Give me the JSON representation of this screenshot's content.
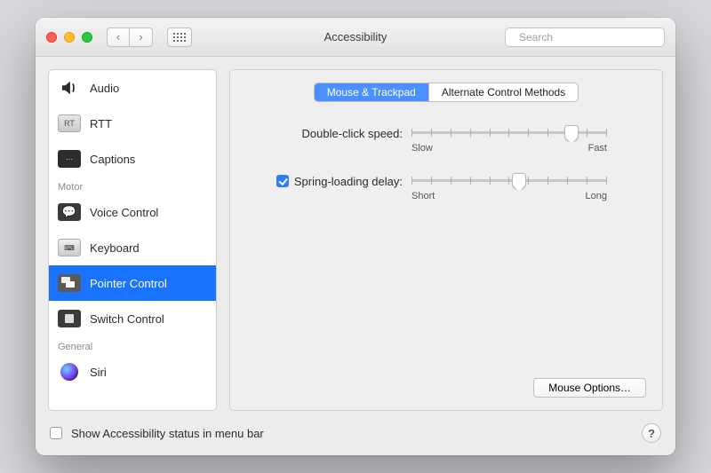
{
  "window": {
    "title": "Accessibility"
  },
  "search": {
    "placeholder": "Search",
    "value": ""
  },
  "sidebar": {
    "groups": [
      {
        "label": "",
        "items": [
          {
            "label": "Audio"
          },
          {
            "label": "RTT"
          },
          {
            "label": "Captions"
          }
        ]
      },
      {
        "label": "Motor",
        "items": [
          {
            "label": "Voice Control"
          },
          {
            "label": "Keyboard"
          },
          {
            "label": "Pointer Control",
            "selected": true
          },
          {
            "label": "Switch Control"
          }
        ]
      },
      {
        "label": "General",
        "items": [
          {
            "label": "Siri"
          }
        ]
      }
    ]
  },
  "tabs": {
    "items": [
      {
        "label": "Mouse & Trackpad",
        "active": true
      },
      {
        "label": "Alternate Control Methods",
        "active": false
      }
    ]
  },
  "sliders": {
    "double_click": {
      "label": "Double-click speed:",
      "min_label": "Slow",
      "max_label": "Fast",
      "value_pct": 82
    },
    "spring_loading": {
      "label": "Spring-loading delay:",
      "checked": true,
      "min_label": "Short",
      "max_label": "Long",
      "value_pct": 55
    }
  },
  "buttons": {
    "mouse_options": "Mouse Options…"
  },
  "footer": {
    "show_status_label": "Show Accessibility status in menu bar",
    "show_status_checked": false
  }
}
